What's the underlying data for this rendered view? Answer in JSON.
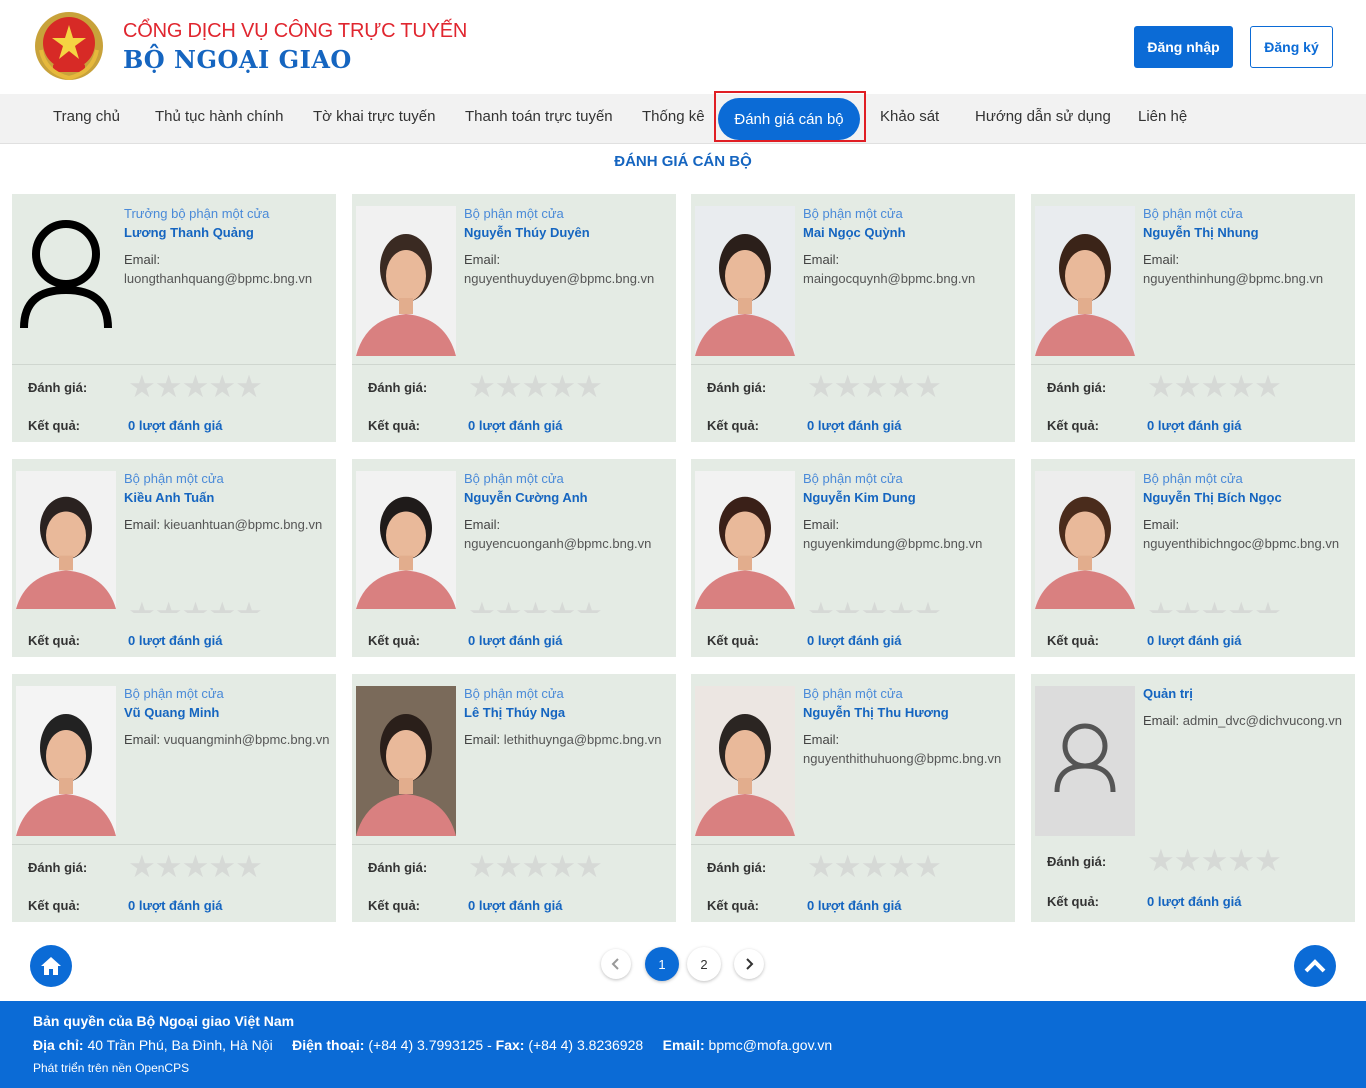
{
  "header": {
    "portal_title": "CỔNG DỊCH VỤ CÔNG TRỰC TUYẾN",
    "ministry": "BỘ NGOẠI GIAO",
    "login_label": "Đăng nhập",
    "register_label": "Đăng ký"
  },
  "nav": {
    "items": [
      {
        "label": "Trang chủ"
      },
      {
        "label": "Thủ tục hành chính"
      },
      {
        "label": "Tờ khai trực tuyến"
      },
      {
        "label": "Thanh toán trực tuyến"
      },
      {
        "label": "Thống kê"
      },
      {
        "label": "Đánh giá cán bộ",
        "active": true
      },
      {
        "label": "Khảo sát"
      },
      {
        "label": "Hướng dẫn sử dụng"
      },
      {
        "label": "Liên hệ"
      }
    ]
  },
  "page_title": "ĐÁNH GIÁ CÁN BỘ",
  "labels": {
    "rating": "Đánh giá:",
    "result": "Kết quả:",
    "email": "Email:"
  },
  "staff": [
    {
      "role": "Trưởng bộ phận một cửa",
      "name": "Lương Thanh Quảng",
      "email": "luongthanhquang@bpmc.bng.vn",
      "result": "0 lượt đánh giá",
      "rating": 0
    },
    {
      "role": "Bộ phận một cửa",
      "name": "Nguyễn Thúy Duyên",
      "email": "nguyenthuyduyen@bpmc.bng.vn",
      "result": "0 lượt đánh giá",
      "rating": 0
    },
    {
      "role": "Bộ phận một cửa",
      "name": "Mai Ngọc Quỳnh",
      "email": "maingocquynh@bpmc.bng.vn",
      "result": "0 lượt đánh giá",
      "rating": 0
    },
    {
      "role": "Bộ phận một cửa",
      "name": "Nguyễn Thị Nhung",
      "email": "nguyenthinhung@bpmc.bng.vn",
      "result": "0 lượt đánh giá",
      "rating": 0
    },
    {
      "role": "Bộ phận một cửa",
      "name": "Kiều Anh Tuấn",
      "email": "kieuanhtuan@bpmc.bng.vn",
      "result": "0 lượt đánh giá",
      "rating": 0
    },
    {
      "role": "Bộ phận một cửa",
      "name": "Nguyễn Cường Anh",
      "email": "nguyencuonganh@bpmc.bng.vn",
      "result": "0 lượt đánh giá",
      "rating": 0
    },
    {
      "role": "Bộ phận một cửa",
      "name": "Nguyễn Kim Dung",
      "email": "nguyenkimdung@bpmc.bng.vn",
      "result": "0 lượt đánh giá",
      "rating": 0
    },
    {
      "role": "Bộ phận một cửa",
      "name": "Nguyễn Thị Bích Ngọc",
      "email": "nguyenthibichngoc@bpmc.bng.vn",
      "result": "0 lượt đánh giá",
      "rating": 0
    },
    {
      "role": "Bộ phận một cửa",
      "name": "Vũ Quang Minh",
      "email": "vuquangminh@bpmc.bng.vn",
      "result": "0 lượt đánh giá",
      "rating": 0
    },
    {
      "role": "Bộ phận một cửa",
      "name": "Lê Thị Thúy Nga",
      "email": "lethithuynga@bpmc.bng.vn",
      "result": "0 lượt đánh giá",
      "rating": 0
    },
    {
      "role": "Bộ phận một cửa",
      "name": "Nguyễn Thị Thu Hương",
      "email": "nguyenthithuhuong@bpmc.bng.vn",
      "result": "0 lượt đánh giá",
      "rating": 0
    },
    {
      "role": "",
      "name": "Quản trị",
      "email": "admin_dvc@dichvucong.vn",
      "result": "0 lượt đánh giá",
      "rating": 0
    }
  ],
  "pagination": {
    "pages": [
      "1",
      "2"
    ],
    "current": "1"
  },
  "footer": {
    "copyright": "Bản quyền của Bộ Ngoại giao Việt Nam",
    "address_label": "Địa chỉ:",
    "address": "40 Trần Phú, Ba Đình, Hà Nội",
    "phone_label": "Điện thoại:",
    "phone": "(+84 4) 3.7993125",
    "fax_label": "Fax:",
    "fax": "(+84 4) 3.8236928",
    "email_label": "Email:",
    "email": "bpmc@mofa.gov.vn",
    "powered": "Phát triển trên nền OpenCPS"
  },
  "colors": {
    "primary": "#0b6bd6",
    "brand_red": "#e0262f",
    "card_bg": "#e4ebe4",
    "highlight": "#e01e24"
  },
  "icons": {
    "home": "home-icon",
    "scroll_top": "chevron-up-icon",
    "prev": "chevron-left-icon",
    "next": "chevron-right-icon"
  }
}
